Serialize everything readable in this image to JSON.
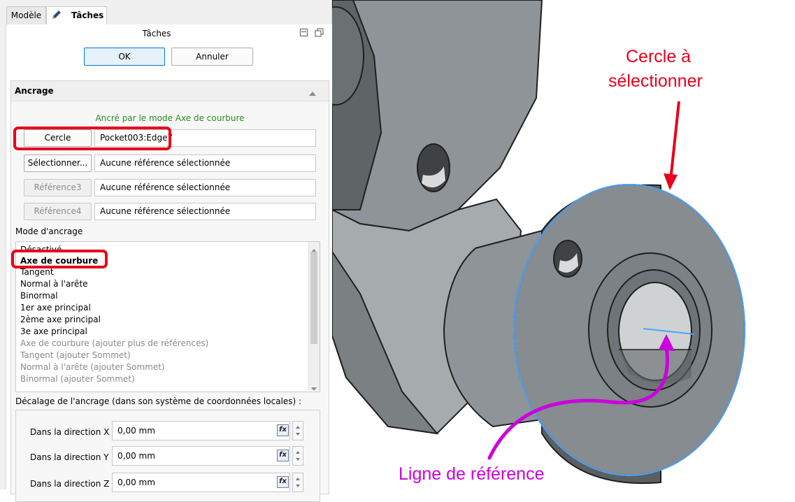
{
  "tabs": {
    "model": "Modèle",
    "tasks": "Tâches"
  },
  "tasks_title": "Tâches",
  "buttons": {
    "ok": "OK",
    "cancel": "Annuler"
  },
  "section": {
    "title": "Ancrage"
  },
  "attach_status": "Ancré par le mode Axe de courbure",
  "references": [
    {
      "button": "Cercle",
      "value": "Pocket003:Edge7"
    },
    {
      "button": "Sélectionner...",
      "value": "Aucune référence sélectionnée"
    },
    {
      "button": "Référence3",
      "value": "Aucune référence sélectionnée"
    },
    {
      "button": "Référence4",
      "value": "Aucune référence sélectionnée"
    }
  ],
  "attach_mode_label": "Mode d'ancrage",
  "attach_modes": [
    "Désactivé",
    "Axe de courbure",
    "Tangent",
    "Normal à l'arête",
    "Binormal",
    "1er axe principal",
    "2ème axe principal",
    "3e axe principal",
    "Axe de courbure (ajouter plus de références)",
    "Tangent (ajouter Sommet)",
    "Normal à l'arête (ajouter Sommet)",
    "Binormal (ajouter Sommet)"
  ],
  "offset_label": "Décalage de l'ancrage (dans son système de coordonnées locales) :",
  "offsets": [
    {
      "label": "Dans la direction X",
      "value": "0,00 mm"
    },
    {
      "label": "Dans la direction Y",
      "value": "0,00 mm"
    },
    {
      "label": "Dans la direction Z",
      "value": "0,00 mm"
    }
  ],
  "annotations": {
    "circle_line1": "Cercle à",
    "circle_line2": "sélectionner",
    "reference_line": "Ligne de référence"
  },
  "colors": {
    "annotation_red": "#e8001c",
    "annotation_magenta": "#cc00dd",
    "status_green": "#2a8a1e",
    "edge_blue": "#4da3ff"
  }
}
